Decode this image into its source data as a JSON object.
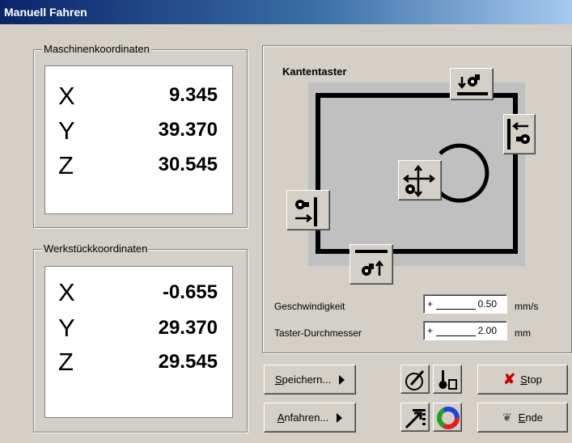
{
  "window": {
    "title": "Manuell Fahren"
  },
  "machine": {
    "label": "Maschinenkoordinaten",
    "axes": [
      "X",
      "Y",
      "Z"
    ],
    "values": [
      "9.345",
      "39.370",
      "30.545"
    ]
  },
  "workpiece": {
    "label": "Werkstückkoordinaten",
    "axes": [
      "X",
      "Y",
      "Z"
    ],
    "values": [
      "-0.655",
      "29.370",
      "29.545"
    ]
  },
  "probe": {
    "title": "Kantentaster",
    "speed_label": "Geschwindigkeit",
    "speed_sign": "+",
    "speed_value": "0.50",
    "speed_unit": "mm/s",
    "diameter_label": "Taster-Durchmesser",
    "diameter_sign": "+",
    "diameter_value": "2.00",
    "diameter_unit": "mm"
  },
  "buttons": {
    "save_label": "Speichern...",
    "approach_label": "Anfahren...",
    "stop_label": "Stop",
    "end_label": "Ende"
  },
  "icons": {
    "probe_top": "probe-top-edge-icon",
    "probe_right": "probe-right-edge-icon",
    "probe_left": "probe-left-edge-icon",
    "probe_bottom": "probe-bottom-edge-icon",
    "probe_center": "probe-circle-center-icon",
    "gauge": "gauge-icon",
    "probe_tool": "probe-tool-icon",
    "path": "path-icon",
    "color_wheel": "color-wheel-icon",
    "stop": "red-x-icon",
    "end": "footprints-icon"
  },
  "colors": {
    "title_start": "#0a246a",
    "title_end": "#a6caf0",
    "stop_x": "#cc0000",
    "panel_bg": "#d4d0c8",
    "probe_area": "#c0c0c0"
  }
}
